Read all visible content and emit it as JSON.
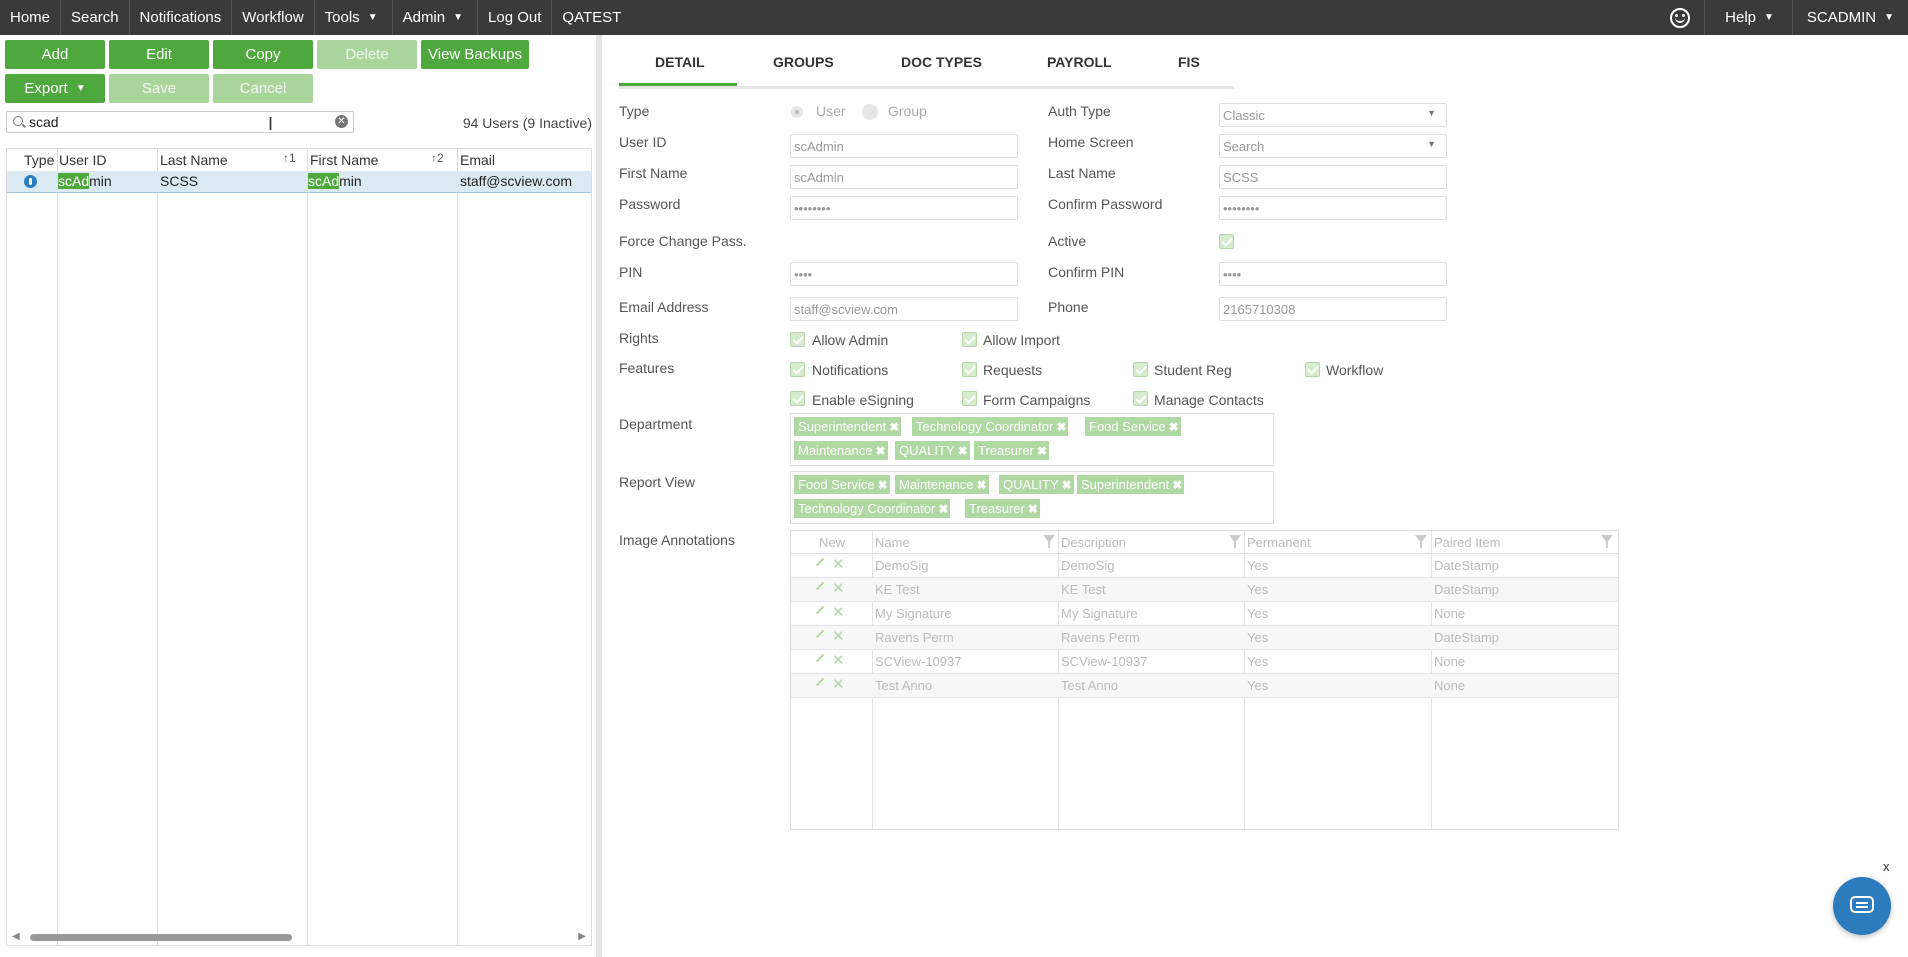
{
  "nav": {
    "items": [
      {
        "label": "Home",
        "dropdown": false
      },
      {
        "label": "Search",
        "dropdown": false
      },
      {
        "label": "Notifications",
        "dropdown": false
      },
      {
        "label": "Workflow",
        "dropdown": false
      },
      {
        "label": "Tools",
        "dropdown": true
      },
      {
        "label": "Admin",
        "dropdown": true
      },
      {
        "label": "Log Out",
        "dropdown": false
      },
      {
        "label": "QATEST",
        "dropdown": false
      }
    ],
    "help": "Help",
    "user": "SCADMIN"
  },
  "toolbar": {
    "add": "Add",
    "edit": "Edit",
    "copy": "Copy",
    "delete": "Delete",
    "view_backups": "View Backups",
    "export": "Export",
    "save": "Save",
    "cancel": "Cancel"
  },
  "search": {
    "value": "scad",
    "count": "94 Users (9 Inactive)"
  },
  "grid": {
    "columns": {
      "type": "Type",
      "user_id": "User ID",
      "last_name": "Last Name",
      "first_name": "First Name",
      "email": "Email"
    },
    "sort": {
      "last_name": "1",
      "first_name": "2"
    },
    "row": {
      "user_id_hl": "scAd",
      "user_id_rest": "min",
      "last_name": "SCSS",
      "first_name_hl": "scAd",
      "first_name_rest": "min",
      "email": "staff@scview.com"
    }
  },
  "tabs": [
    "DETAIL",
    "GROUPS",
    "DOC TYPES",
    "PAYROLL",
    "FIS"
  ],
  "detail": {
    "type_label": "Type",
    "type_user": "User",
    "type_group": "Group",
    "auth_label": "Auth Type",
    "auth_value": "Classic",
    "userid_label": "User ID",
    "userid_value": "scAdmin",
    "home_label": "Home Screen",
    "home_value": "Search",
    "first_label": "First Name",
    "first_value": "scAdmin",
    "last_label": "Last Name",
    "last_value": "SCSS",
    "pw_label": "Password",
    "pw_value": "••••••••",
    "cpw_label": "Confirm Password",
    "cpw_value": "••••••••",
    "force_label": "Force Change Pass.",
    "active_label": "Active",
    "pin_label": "PIN",
    "pin_value": "••••",
    "cpin_label": "Confirm PIN",
    "cpin_value": "••••",
    "email_label": "Email Address",
    "email_value": "staff@scview.com",
    "phone_label": "Phone",
    "phone_value": "2165710308",
    "rights_label": "Rights",
    "rights": [
      "Allow Admin",
      "Allow Import"
    ],
    "features_label": "Features",
    "features": [
      "Notifications",
      "Requests",
      "Student Reg",
      "Workflow",
      "Enable eSigning",
      "Form Campaigns",
      "Manage Contacts"
    ],
    "dept_label": "Department",
    "dept_tags": [
      "Superintendent",
      "Technology Coordinator",
      "Food Service",
      "Maintenance",
      "QUALITY",
      "Treasurer"
    ],
    "report_label": "Report View",
    "report_tags": [
      "Food Service",
      "Maintenance",
      "QUALITY",
      "Superintendent",
      "Technology Coordinator",
      "Treasurer"
    ],
    "anno_label": "Image Annotations"
  },
  "annotations": {
    "headers": {
      "new": "New",
      "name": "Name",
      "description": "Description",
      "permanent": "Permanent",
      "paired": "Paired Item"
    },
    "rows": [
      {
        "name": "DemoSig",
        "description": "DemoSig",
        "permanent": "Yes",
        "paired": "DateStamp"
      },
      {
        "name": "KE Test",
        "description": "KE Test",
        "permanent": "Yes",
        "paired": "DateStamp"
      },
      {
        "name": "My Signature",
        "description": "My Signature",
        "permanent": "Yes",
        "paired": "None"
      },
      {
        "name": "Ravens Perm",
        "description": "Ravens Perm",
        "permanent": "Yes",
        "paired": "DateStamp"
      },
      {
        "name": "SCView-10937",
        "description": "SCView-10937",
        "permanent": "Yes",
        "paired": "None"
      },
      {
        "name": "Test Anno",
        "description": "Test Anno",
        "permanent": "Yes",
        "paired": "None"
      }
    ]
  },
  "chat": {
    "close": "x"
  },
  "colors": {
    "accent": "#4fa83d",
    "accent_disabled": "#a9d59d",
    "nav_bg": "#3a3a3a",
    "chat": "#2b7bbd"
  }
}
